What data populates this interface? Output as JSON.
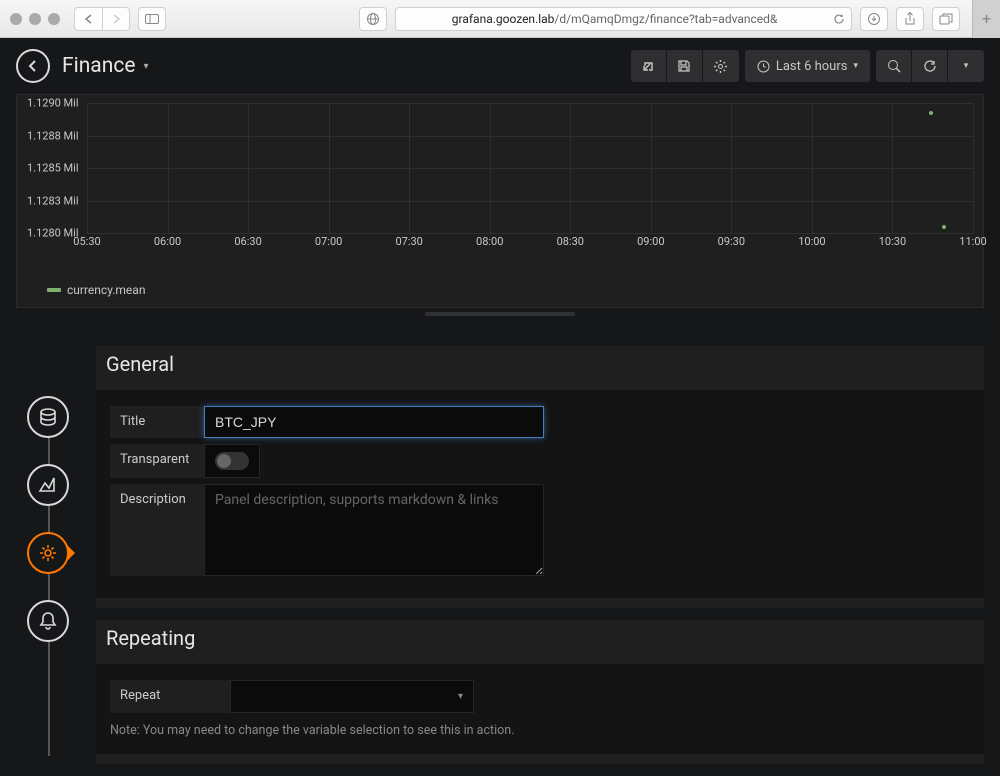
{
  "browser": {
    "url_domain": "grafana.goozen.lab",
    "url_path": "/d/mQamqDmgz/finance?tab=advanced&"
  },
  "header": {
    "title": "Finance",
    "time_range": "Last 6 hours"
  },
  "chart_data": {
    "type": "line",
    "title": "",
    "xlabel": "",
    "ylabel": "",
    "y_ticks": [
      "1.1290 Mil",
      "1.1288 Mil",
      "1.1285 Mil",
      "1.1283 Mil",
      "1.1280 Mil"
    ],
    "x_ticks": [
      "05:30",
      "06:00",
      "06:30",
      "07:00",
      "07:30",
      "08:00",
      "08:30",
      "09:00",
      "09:30",
      "10:00",
      "10:30",
      "11:00"
    ],
    "ylim": [
      1128000,
      1129000
    ],
    "series": [
      {
        "name": "currency.mean",
        "color": "#7eb26d",
        "points": [
          {
            "x": "11:10",
            "y": 1128950
          },
          {
            "x": "11:15",
            "y": 1128050
          }
        ]
      }
    ],
    "legend": [
      "currency.mean"
    ]
  },
  "editor": {
    "general": {
      "heading": "General",
      "title_label": "Title",
      "title_value": "BTC_JPY",
      "transparent_label": "Transparent",
      "transparent_value": false,
      "description_label": "Description",
      "description_placeholder": "Panel description, supports markdown & links",
      "description_value": ""
    },
    "repeating": {
      "heading": "Repeating",
      "repeat_label": "Repeat",
      "repeat_value": "",
      "note": "Note: You may need to change the variable selection to see this in action."
    }
  }
}
